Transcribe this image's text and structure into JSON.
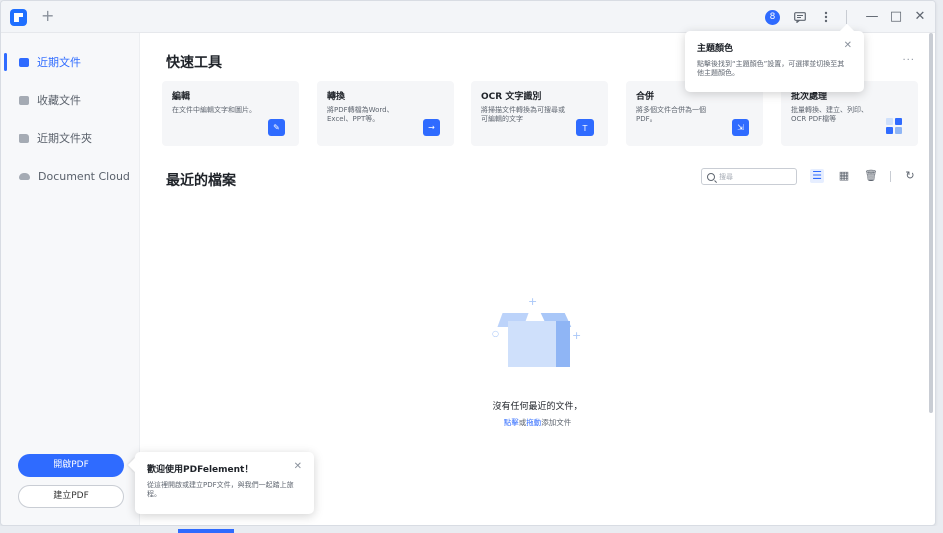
{
  "titlebar": {
    "new_tab": "+",
    "avatar": "8",
    "icons": [
      "avatar-icon",
      "message-icon",
      "more-vertical-icon"
    ],
    "window_controls": [
      "—",
      "□",
      "✕"
    ]
  },
  "sidebar": {
    "items": [
      {
        "label": "近期文件",
        "icon": "document-icon",
        "active": true
      },
      {
        "label": "收藏文件",
        "icon": "star-icon",
        "active": false
      },
      {
        "label": "近期文件夾",
        "icon": "folder-icon",
        "active": false
      },
      {
        "label": "Document Cloud",
        "icon": "cloud-icon",
        "active": false
      }
    ],
    "open_pdf": "開啟PDF",
    "create_pdf": "建立PDF"
  },
  "quick_tools": {
    "title": "快速工具",
    "more": "···",
    "cards": [
      {
        "title": "編輯",
        "desc": "在文件中編輯文字和圖片。",
        "icon": "edit-icon"
      },
      {
        "title": "轉換",
        "desc": "將PDF轉檔為Word、Excel、PPT等。",
        "icon": "convert-icon"
      },
      {
        "title": "OCR 文字識別",
        "desc": "將掃描文件轉換為可搜尋或可編輯的文字",
        "icon": "ocr-icon"
      },
      {
        "title": "合併",
        "desc": "將多個文件合併為一個PDF。",
        "icon": "merge-icon"
      },
      {
        "title": "批次處理",
        "desc": "批量轉換、建立、列印、OCR PDF檔等",
        "icon": "batch-icon"
      }
    ]
  },
  "recent": {
    "title": "最近的檔案",
    "search_placeholder": "搜尋",
    "empty_title": "沒有任何最近的文件，",
    "empty_link1": "點擊",
    "empty_mid": "或",
    "empty_link2": "拖動",
    "empty_tail": "添加文件"
  },
  "popover_theme": {
    "title": "主題顏色",
    "desc": "點擊後找到“主題顏色”設置，可選擇並切換至其他主題顏色。",
    "close": "✕"
  },
  "popover_welcome": {
    "title": "歡迎使用PDFelement！",
    "desc": "從這裡開啟或建立PDF文件，與我們一起踏上旅程。",
    "close": "✕"
  },
  "colors": {
    "accent": "#2f6bff",
    "sidebar_bg": "#f7f8fa",
    "card_bg": "#f5f6f8"
  }
}
